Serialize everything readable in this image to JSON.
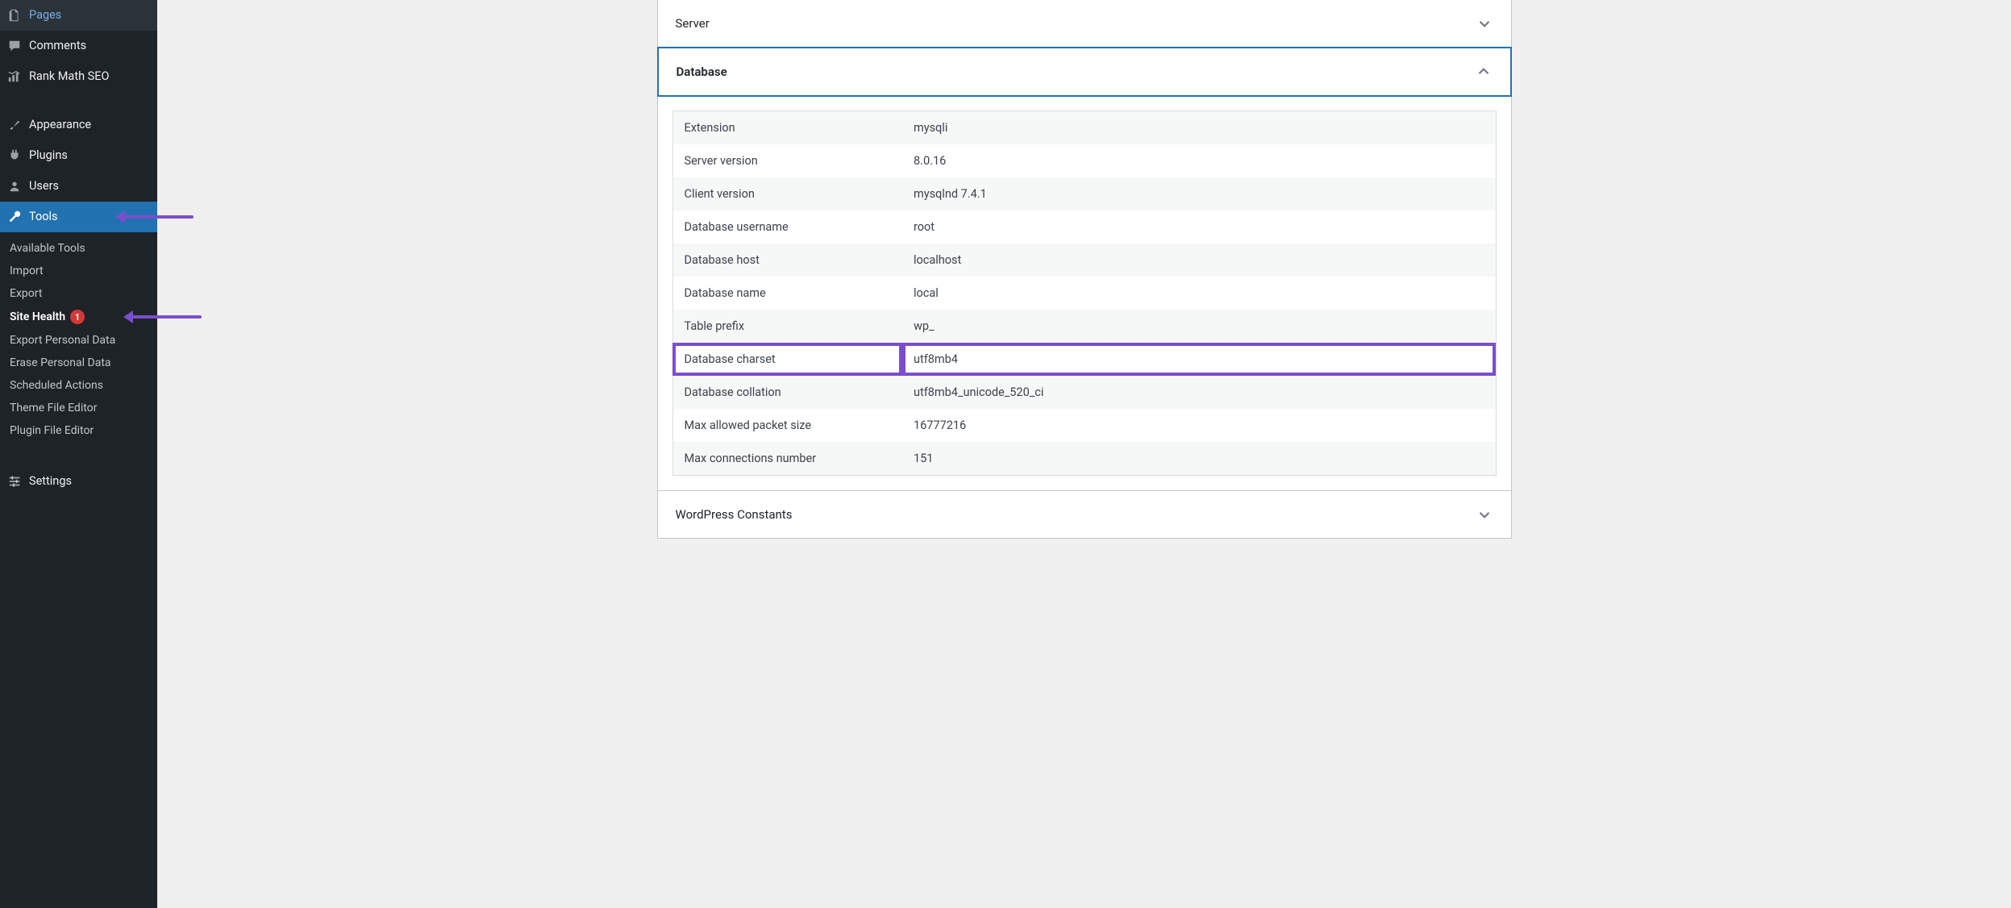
{
  "sidebar": {
    "main": [
      {
        "id": "pages",
        "label": "Pages",
        "icon": "pages"
      },
      {
        "id": "comments",
        "label": "Comments",
        "icon": "comment"
      },
      {
        "id": "rankmath",
        "label": "Rank Math SEO",
        "icon": "chart-bars"
      }
    ],
    "secondary": [
      {
        "id": "appearance",
        "label": "Appearance",
        "icon": "brush"
      },
      {
        "id": "plugins",
        "label": "Plugins",
        "icon": "plug"
      },
      {
        "id": "users",
        "label": "Users",
        "icon": "user"
      },
      {
        "id": "tools",
        "label": "Tools",
        "icon": "wrench",
        "active": true
      },
      {
        "id": "settings",
        "label": "Settings",
        "icon": "sliders"
      }
    ],
    "submenu": [
      {
        "id": "available-tools",
        "label": "Available Tools"
      },
      {
        "id": "import",
        "label": "Import"
      },
      {
        "id": "export",
        "label": "Export"
      },
      {
        "id": "site-health",
        "label": "Site Health",
        "badge": "1",
        "current": true
      },
      {
        "id": "export-personal-data",
        "label": "Export Personal Data"
      },
      {
        "id": "erase-personal-data",
        "label": "Erase Personal Data"
      },
      {
        "id": "scheduled-actions",
        "label": "Scheduled Actions"
      },
      {
        "id": "theme-file-editor",
        "label": "Theme File Editor"
      },
      {
        "id": "plugin-file-editor",
        "label": "Plugin File Editor"
      }
    ]
  },
  "panels": {
    "server": {
      "title": "Server",
      "expanded": false
    },
    "database": {
      "title": "Database",
      "expanded": true,
      "rows": [
        {
          "label": "Extension",
          "value": "mysqli"
        },
        {
          "label": "Server version",
          "value": "8.0.16"
        },
        {
          "label": "Client version",
          "value": "mysqlnd 7.4.1"
        },
        {
          "label": "Database username",
          "value": "root"
        },
        {
          "label": "Database host",
          "value": "localhost"
        },
        {
          "label": "Database name",
          "value": "local"
        },
        {
          "label": "Table prefix",
          "value": "wp_"
        },
        {
          "label": "Database charset",
          "value": "utf8mb4",
          "highlight": true
        },
        {
          "label": "Database collation",
          "value": "utf8mb4_unicode_520_ci"
        },
        {
          "label": "Max allowed packet size",
          "value": "16777216"
        },
        {
          "label": "Max connections number",
          "value": "151"
        }
      ]
    },
    "constants": {
      "title": "WordPress Constants",
      "expanded": false
    }
  }
}
